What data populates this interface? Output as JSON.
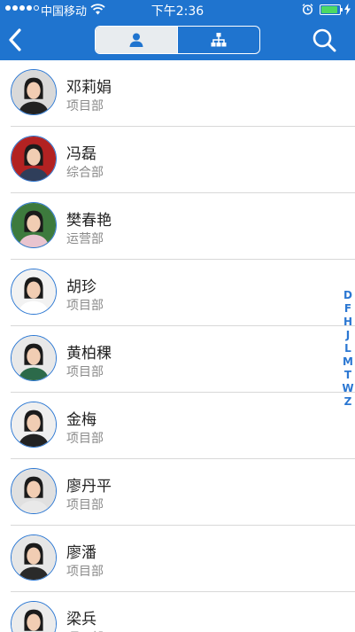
{
  "status_bar": {
    "carrier": "中国移动",
    "time": "下午2:36",
    "battery_level": 0.9,
    "signal_bars": 4
  },
  "header": {
    "back_icon": "chevron-left-icon",
    "tabs": [
      {
        "icon": "person-icon",
        "active": true
      },
      {
        "icon": "org-chart-icon",
        "active": false
      }
    ],
    "search_icon": "search-icon"
  },
  "colors": {
    "header_bg": "#1f74cf",
    "avatar_ring": "#2b77d2",
    "index_text": "#2b77d2",
    "tab_active_bg": "#e8ecef"
  },
  "contacts": [
    {
      "name": "邓莉娟",
      "dept": "项目部",
      "avatar_bg": "#d9d9d9",
      "shirt": "#222"
    },
    {
      "name": "冯磊",
      "dept": "综合部",
      "avatar_bg": "#b22222",
      "shirt": "#2f3e5a"
    },
    {
      "name": "樊春艳",
      "dept": "运营部",
      "avatar_bg": "#3d7a3d",
      "shirt": "#e9c4cf"
    },
    {
      "name": "胡珍",
      "dept": "项目部",
      "avatar_bg": "#f2f2f2",
      "shirt": "#ffffff"
    },
    {
      "name": "黄柏稞",
      "dept": "项目部",
      "avatar_bg": "#e8e8e8",
      "shirt": "#2c6a4a"
    },
    {
      "name": "金梅",
      "dept": "项目部",
      "avatar_bg": "#efefef",
      "shirt": "#222"
    },
    {
      "name": "廖丹平",
      "dept": "项目部",
      "avatar_bg": "#e0e0e0",
      "shirt": "#e9e9e9"
    },
    {
      "name": "廖潘",
      "dept": "项目部",
      "avatar_bg": "#e6e6e6",
      "shirt": "#2a2a2a"
    },
    {
      "name": "梁兵",
      "dept": "项目部",
      "avatar_bg": "#ececec",
      "shirt": "#2a4b80"
    }
  ],
  "index_letters": [
    "D",
    "F",
    "H",
    "J",
    "L",
    "M",
    "T",
    "W",
    "Z"
  ]
}
